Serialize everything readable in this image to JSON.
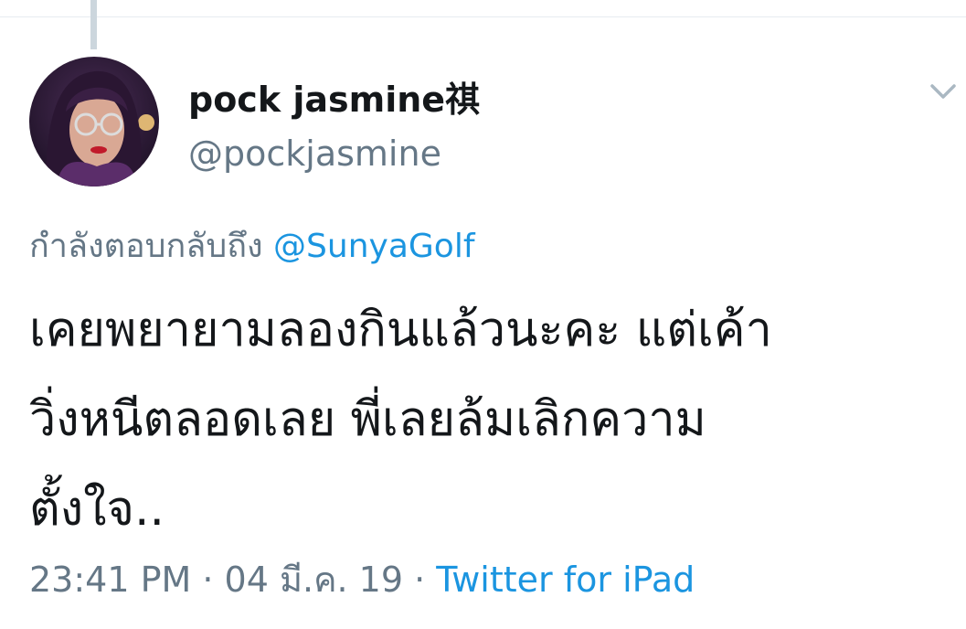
{
  "author": {
    "display_name": "pock jasmine祺",
    "handle": "@pockjasmine"
  },
  "reply": {
    "prefix": "กำลังตอบกลับถึง",
    "mention": "@SunyaGolf"
  },
  "tweet": {
    "lines": [
      "เคยพยายามลองกินแล้วนะคะ แต่เค้า",
      "วิ่งหนีตลอดเลย พี่เลยล้มเลิกความ",
      "ตั้งใจ.."
    ]
  },
  "meta": {
    "time": "23:41 PM",
    "sep1": " · ",
    "date": "04 มี.ค. 19",
    "sep2": " · ",
    "source": "Twitter for iPad"
  },
  "icons": {
    "avatar": "avatar-image",
    "more": "chevron-down-icon"
  },
  "colors": {
    "text": "#14171a",
    "secondary": "#657786",
    "link": "#1b95e0",
    "thread_line": "#ccd6dd"
  }
}
